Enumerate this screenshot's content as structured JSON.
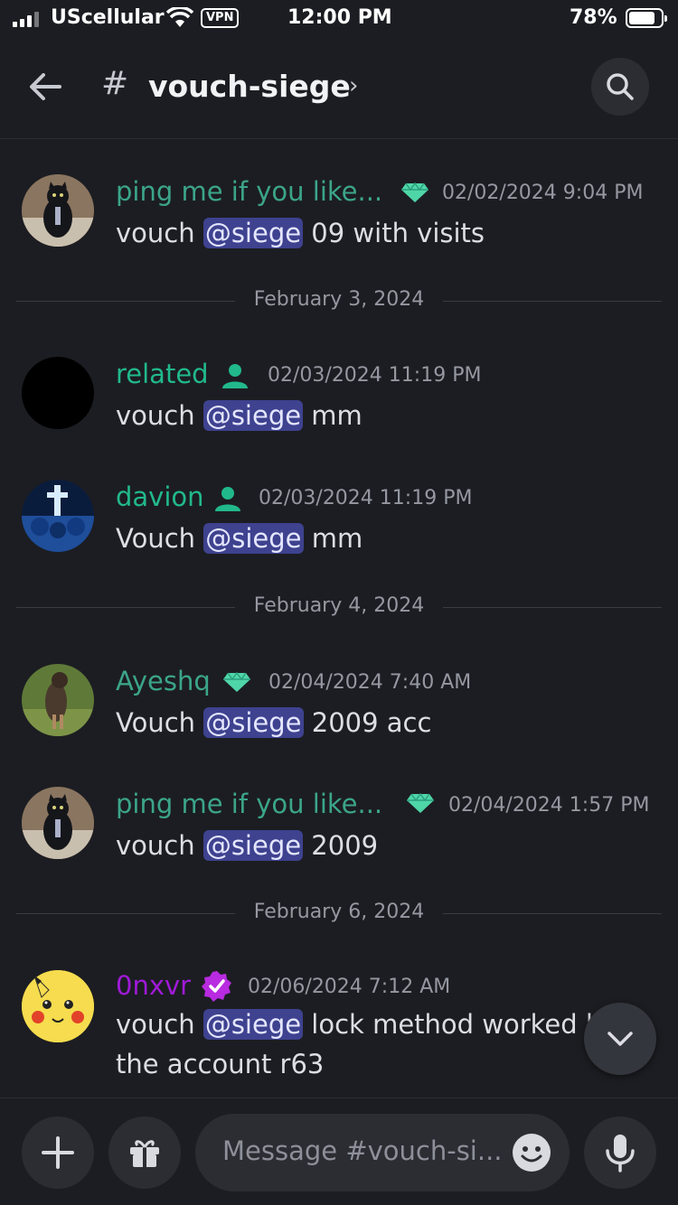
{
  "status_bar": {
    "carrier": "UScellular",
    "vpn": "VPN",
    "time": "12:00 PM",
    "battery": "78%"
  },
  "header": {
    "hash": "#",
    "channel_name": "vouch-siege",
    "chevron": "›"
  },
  "messages": [
    {
      "author": "ping me if you like...",
      "author_color": "#3ba58a",
      "badge": "diamond-icon",
      "timestamp": "02/02/2024 9:04 PM",
      "prefix": "vouch ",
      "mention": "@siege",
      "suffix": "  09 with visits"
    },
    {
      "type": "divider",
      "date": "February 3, 2024"
    },
    {
      "author": "related",
      "author_color": "#21b98c",
      "badge": "person-icon",
      "timestamp": "02/03/2024 11:19 PM",
      "prefix": "vouch ",
      "mention": "@siege",
      "suffix": " mm"
    },
    {
      "author": "davion",
      "author_color": "#21b98c",
      "badge": "person-icon",
      "timestamp": "02/03/2024 11:19 PM",
      "prefix": "Vouch ",
      "mention": "@siege",
      "suffix": " mm"
    },
    {
      "type": "divider",
      "date": "February 4, 2024"
    },
    {
      "author": "Ayeshq",
      "author_color": "#3ba58a",
      "badge": "diamond-icon",
      "timestamp": "02/04/2024 7:40 AM",
      "prefix": "Vouch ",
      "mention": "@siege",
      "suffix": " 2009 acc"
    },
    {
      "author": "ping me if you like...",
      "author_color": "#3ba58a",
      "badge": "diamond-icon",
      "timestamp": "02/04/2024 1:57 PM",
      "prefix": "vouch ",
      "mention": "@siege",
      "suffix": " 2009"
    },
    {
      "type": "divider",
      "date": "February 6, 2024"
    },
    {
      "author": "0nxvr",
      "author_color": "#a01ad8",
      "badge": "verified-icon",
      "timestamp": "02/06/2024 7:12 AM",
      "prefix": "vouch ",
      "mention": "@siege",
      "suffix": " lock method worked l",
      "line2": "the account r63"
    }
  ],
  "composer": {
    "placeholder": "Message #vouch-si..."
  }
}
